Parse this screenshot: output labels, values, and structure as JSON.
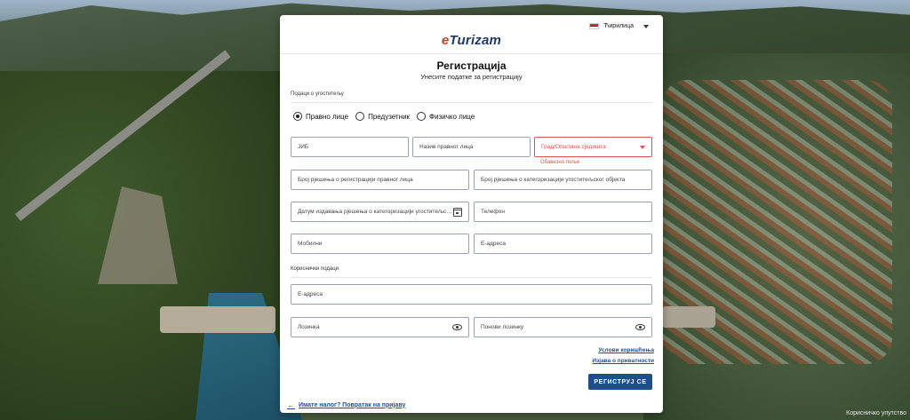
{
  "language": {
    "selected": "Ћирилица"
  },
  "brand": {
    "prefix": "e",
    "name": "Turizam"
  },
  "heading": {
    "title": "Регистрација",
    "subtitle": "Унесите податке за регистрацију"
  },
  "sections": {
    "business": "Подаци о угоститељу",
    "user": "Кориснички подаци"
  },
  "entity_types": [
    {
      "label": "Правно лице",
      "selected": true
    },
    {
      "label": "Предузетник",
      "selected": false
    },
    {
      "label": "Физичко лице",
      "selected": false
    }
  ],
  "fields": {
    "jib": "ЈИБ",
    "legal_name": "Назив правног лица",
    "city": "Град/Општина сједишта",
    "city_error": "Обавезно поље",
    "registration_decision": "Број рјешења о регистрацији правног лица",
    "categorization_decision": "Број рјешења о категоризацији угоститељског објекта",
    "issue_date": "Датум издавања рјешења о категоризацији угоститељског објекта",
    "phone": "Телефон",
    "mobile": "Мобилни",
    "email": "Е-адреса",
    "user_email": "Е-адреса",
    "password": "Лозинка",
    "password_repeat": "Понови лозинку"
  },
  "links": {
    "terms": "Услови коришћења",
    "privacy": "Изјава о приватности",
    "back": "Имате налог? Повратак на пријаву"
  },
  "buttons": {
    "register": "РЕГИСТРУЈ СЕ"
  },
  "credit": "Корисничко упутство",
  "colors": {
    "primary": "#1f4e8c",
    "error": "#d9534f",
    "link": "#1f4fa0",
    "logo": "#1e3a68",
    "logo_accent": "#d23a2a"
  }
}
